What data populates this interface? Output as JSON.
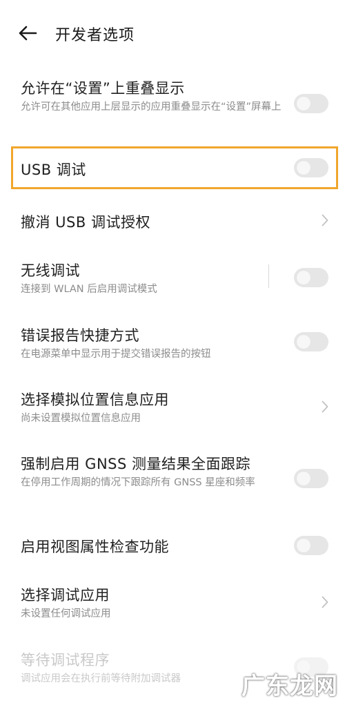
{
  "header": {
    "title": "开发者选项"
  },
  "items": [
    {
      "label": "允许在“设置”上重叠显示",
      "desc": "允许可在其他应用上层显示的应用重叠显示在“设置”屏幕上",
      "control": "toggle",
      "state": "off"
    },
    {
      "label": "USB 调试",
      "desc": "",
      "control": "toggle",
      "state": "off",
      "highlighted": true
    },
    {
      "label": "撤消 USB 调试授权",
      "desc": "",
      "control": "chevron"
    },
    {
      "label": "无线调试",
      "desc": "连接到 WLAN 后启用调试模式",
      "control": "toggle",
      "state": "off"
    },
    {
      "label": "错误报告快捷方式",
      "desc": "在电源菜单中显示用于提交错误报告的按钮",
      "control": "toggle",
      "state": "off"
    },
    {
      "label": "选择模拟位置信息应用",
      "desc": "尚未设置模拟位置信息应用",
      "control": "chevron"
    },
    {
      "label": "强制启用 GNSS 测量结果全面跟踪",
      "desc": "在停用工作周期的情况下跟踪所有 GNSS 星座和频率",
      "control": "toggle",
      "state": "off"
    },
    {
      "label": "启用视图属性检查功能",
      "desc": "",
      "control": "toggle",
      "state": "off"
    },
    {
      "label": "选择调试应用",
      "desc": "未设置任何调试应用",
      "control": "chevron"
    },
    {
      "label": "等待调试程序",
      "desc": "调试应用会在执行前等待附加调试器",
      "control": "toggle",
      "state": "disabled"
    }
  ],
  "colors": {
    "highlight_border": "#f1a62b",
    "toggle_off": "#e6e6e6",
    "secondary_text": "#8c8c8c"
  },
  "watermark": "广东龙网"
}
